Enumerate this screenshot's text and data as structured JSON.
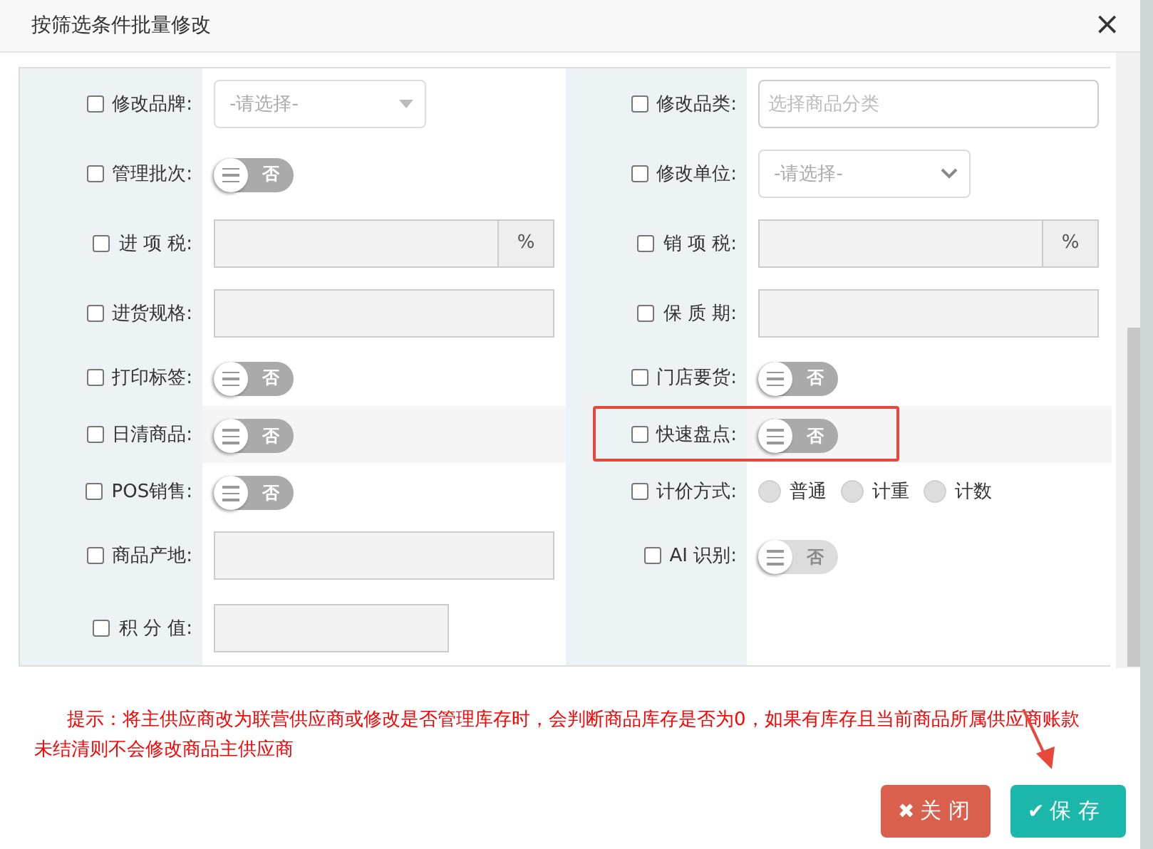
{
  "dialog": {
    "title": "按筛选条件批量修改",
    "close": "×"
  },
  "rows": [
    {
      "cells": [
        {
          "label": "修改品牌:",
          "checked": false,
          "kind": "select",
          "placeholder": "-请选择-"
        },
        {
          "label": "修改品类:",
          "checked": false,
          "kind": "input",
          "placeholder": "选择商品分类"
        }
      ]
    },
    {
      "cells": [
        {
          "label": "管理批次:",
          "checked": false,
          "kind": "toggle",
          "text": "否",
          "on": false,
          "disabled": false
        },
        {
          "label": "修改单位:",
          "checked": false,
          "kind": "dropdown",
          "placeholder": "-请选择-"
        }
      ]
    },
    {
      "cells": [
        {
          "label": "进 项 税:",
          "checked": false,
          "kind": "percent",
          "addon": "%"
        },
        {
          "label": "销 项 税:",
          "checked": false,
          "kind": "percent",
          "addon": "%"
        }
      ]
    },
    {
      "cells": [
        {
          "label": "进货规格:",
          "checked": false,
          "kind": "text"
        },
        {
          "label": "保 质 期:",
          "checked": false,
          "kind": "text"
        }
      ]
    },
    {
      "cells": [
        {
          "label": "打印标签:",
          "checked": false,
          "kind": "toggle",
          "text": "否",
          "on": false,
          "disabled": false
        },
        {
          "label": "门店要货:",
          "checked": false,
          "kind": "toggle",
          "text": "否",
          "on": false,
          "disabled": false
        }
      ]
    },
    {
      "hovered": true,
      "cells": [
        {
          "label": "日清商品:",
          "checked": false,
          "kind": "toggle",
          "text": "否",
          "on": false,
          "disabled": false
        },
        {
          "label": "快速盘点:",
          "checked": false,
          "kind": "toggle",
          "text": "否",
          "on": false,
          "disabled": false,
          "highlighted": true
        }
      ]
    },
    {
      "cells": [
        {
          "label": "POS销售:",
          "checked": false,
          "kind": "toggle",
          "text": "否",
          "on": false,
          "disabled": false
        },
        {
          "label": "计价方式:",
          "checked": false,
          "kind": "radio",
          "options": [
            {
              "label": "普通",
              "selected": false
            },
            {
              "label": "计重",
              "selected": false
            },
            {
              "label": "计数",
              "selected": false
            }
          ]
        }
      ]
    },
    {
      "cells": [
        {
          "label": "商品产地:",
          "checked": false,
          "kind": "text"
        },
        {
          "label": "AI 识别:",
          "checked": false,
          "kind": "toggle",
          "text": "否",
          "on": false,
          "disabled": true
        }
      ]
    },
    {
      "cells": [
        {
          "label": "积 分 值:",
          "checked": false,
          "kind": "short"
        }
      ]
    }
  ],
  "notice": "提示：将主供应商改为联营供应商或修改是否管理库存时，会判断商品库存是否为0，如果有库存且当前商品所属供应商账款未结清则不会修改商品主供应商",
  "buttons": [
    {
      "kind": "close",
      "label": "关 闭",
      "icon": "✖"
    },
    {
      "kind": "save",
      "label": "保 存",
      "icon": "✔"
    }
  ],
  "pointer_arrow": true
}
